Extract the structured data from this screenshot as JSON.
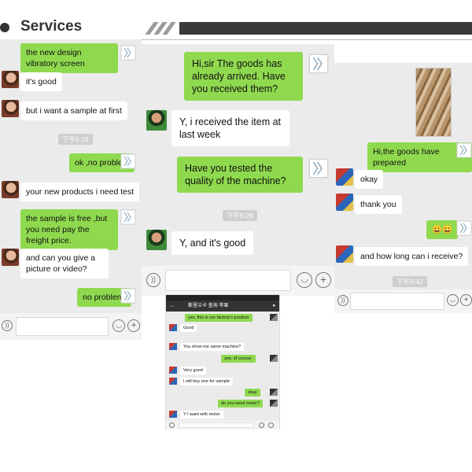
{
  "header": {
    "title": "Services"
  },
  "left_chat": {
    "messages": [
      "the new design vibratory screen",
      "it's good",
      "but i want a sample at first",
      "ok ,no problem",
      "your new products i need test",
      "the sample is free ,but you need pay the freight price.",
      "and can you give a picture or video?",
      "no problem."
    ],
    "timestamp": "下午5:16"
  },
  "middle_chat": {
    "messages": [
      "Hi,sir The goods has already arrived. Have you received them?",
      "Y, i received the item at last week",
      "Have you tested the quality of the machine?",
      "Y,  and it's good"
    ],
    "timestamp": "下午5:29"
  },
  "right_chat": {
    "messages": [
      "Hi,the goods have prepared",
      "okay",
      "thank you",
      "😀😀",
      "and how long can i receive?"
    ],
    "timestamp": "下午5:42"
  },
  "phone_chat": {
    "title": "斯里兰卡 查询 苹果",
    "messages": [
      "yes, this is our factory's product.",
      "Good",
      "You show me same machine?",
      "yes, of course.",
      "Very good",
      "I will buy one for sample",
      "okay",
      "do you need motor?",
      "Y I want with motor"
    ]
  },
  "colors": {
    "sent_bubble": "#8fd94f",
    "received_bubble": "#ffffff",
    "panel_bg": "#ebebeb"
  },
  "icons": [
    "voice-icon",
    "emoji-icon",
    "plus-icon",
    "send-status-icon",
    "back-arrow-icon",
    "contact-icon"
  ]
}
